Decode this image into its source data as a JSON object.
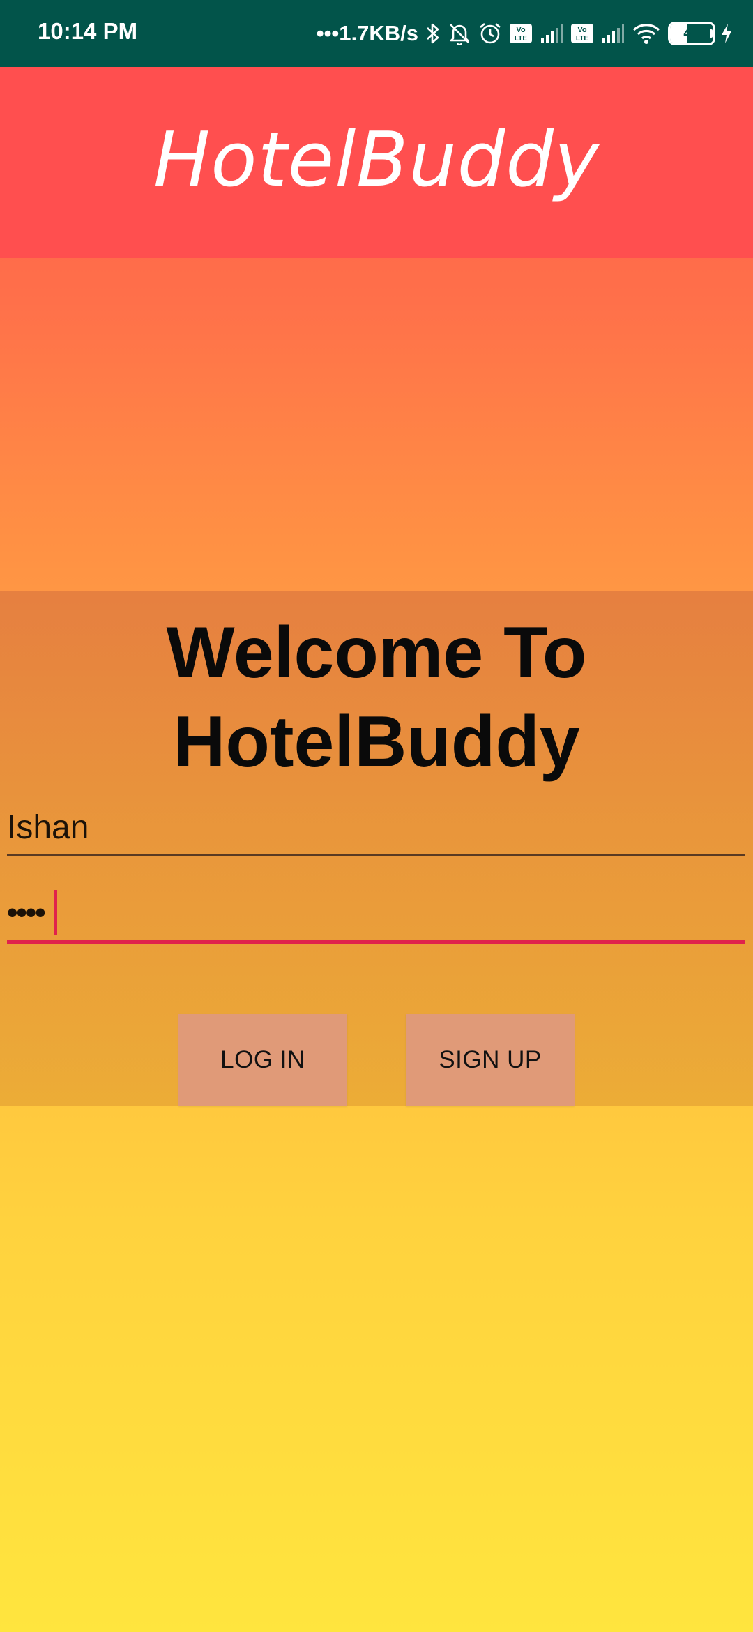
{
  "status_bar": {
    "time": "10:14 PM",
    "net_speed": "•••1.7KB/s",
    "battery_level": "40",
    "icons": [
      "bluetooth-icon",
      "mute-bell-icon",
      "alarm-icon",
      "volte-icon",
      "signal-icon",
      "volte-icon",
      "signal-icon",
      "wifi-icon",
      "battery-icon",
      "charging-icon"
    ],
    "background_color": "#02544a"
  },
  "app_bar": {
    "title": "HotelBuddy",
    "background_color": "#ff4f4f"
  },
  "login": {
    "welcome_line1": "Welcome To",
    "welcome_line2": "HotelBuddy",
    "username_value": "Ishan",
    "password_value": "••••",
    "login_label": "LOG IN",
    "signup_label": "SIGN UP",
    "accent_color": "#e0224c"
  }
}
